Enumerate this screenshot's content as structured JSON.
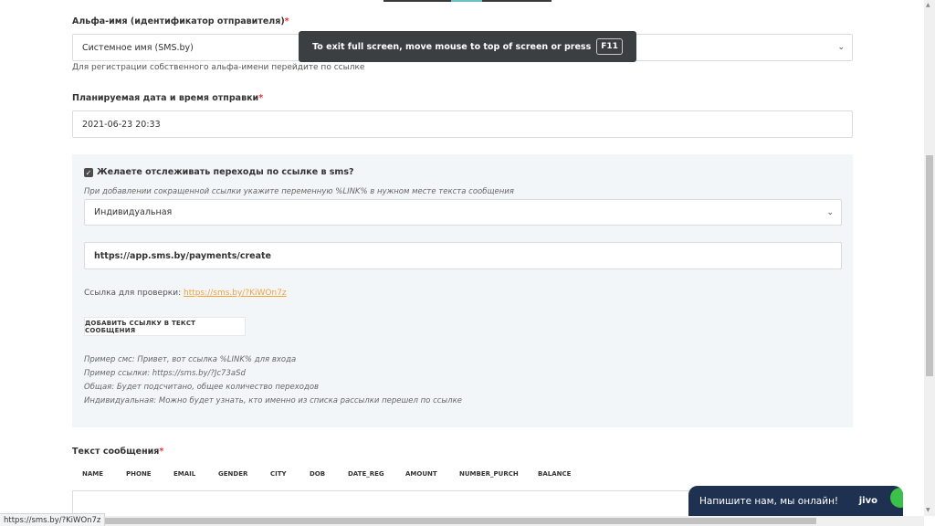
{
  "sender": {
    "label": "Альфа-имя (идентификатор отправителя)",
    "required_mark": "*",
    "value": "Системное имя (SMS.by)",
    "hint_prefix": "Для регистрации собственного альфа-имени ",
    "hint_link": "перейдите по ссылке"
  },
  "schedule": {
    "label": "Планируемая дата и время отправки",
    "required_mark": "*",
    "value": "2021-06-23 20:33"
  },
  "tracking": {
    "checkbox_label": "Желаете отслеживать переходы по ссылке в sms?",
    "checked": true,
    "hint": "При добавлении сокращенной ссылки укажите переменную %LINK% в нужном месте текста сообщения",
    "type_value": "Индивидуальная",
    "url_value": "https://app.sms.by/payments/create",
    "check_prefix": "Ссылка для проверки: ",
    "check_link": "https://sms.by/?KiWOn7z",
    "add_button": "ДОБАВИТЬ ССЫЛКУ В ТЕКСТ СООБЩЕНИЯ",
    "examples": [
      "Пример смс: Привет, вот ссылка %LINK% для входа",
      "Пример ссылки: https://sms.by/?Jc73aSd",
      "Общая: Будет подсчитано, общее количество переходов",
      "Индивидуальная: Можно будет узнать, кто именно из списка рассылки перешел по ссылке"
    ]
  },
  "message": {
    "label": "Текст сообщения",
    "required_mark": "*",
    "variables": [
      "NAME",
      "PHONE",
      "EMAIL",
      "GENDER",
      "CITY",
      "DOB",
      "DATE_REG",
      "AMOUNT",
      "NUMBER_PURCH",
      "BALANCE"
    ]
  },
  "fullscreen_toast": {
    "text": "To exit full screen, move mouse to top of screen or press",
    "key": "F11"
  },
  "status_url": "https://sms.by/?KiWOn7z",
  "chat": {
    "text": "Напишите нам, мы онлайн!",
    "logo": "jivo"
  }
}
